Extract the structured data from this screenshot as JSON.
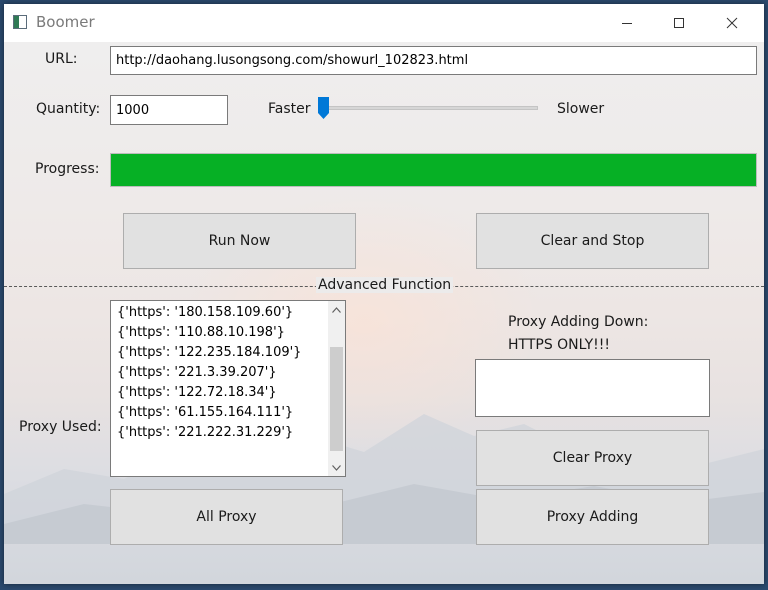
{
  "window": {
    "title": "Boomer"
  },
  "url": {
    "label": "URL:",
    "value": "http://daohang.lusongsong.com/showurl_102823.html"
  },
  "quantity": {
    "label": "Quantity:",
    "value": "1000"
  },
  "speed": {
    "faster_label": "Faster",
    "slower_label": "Slower",
    "level_fraction": 0.0
  },
  "progress": {
    "label": "Progress:",
    "fraction": 1.0,
    "color": "#06b025"
  },
  "buttons": {
    "run_now": "Run Now",
    "clear_and_stop": "Clear and Stop",
    "all_proxy": "All Proxy",
    "clear_proxy": "Clear Proxy",
    "proxy_adding": "Proxy Adding"
  },
  "advanced": {
    "label": "Advanced Function"
  },
  "proxy_used": {
    "label": "Proxy Used:",
    "items": [
      "{'https': '180.158.109.60'}",
      "{'https': '110.88.10.198'}",
      "{'https': '122.235.184.109'}",
      "{'https': '221.3.39.207'}",
      "{'https': '122.72.18.34'}",
      "{'https': '61.155.164.111'}",
      "{'https': '221.222.31.229'}"
    ]
  },
  "proxy_adding": {
    "label_line1": "Proxy Adding Down:",
    "label_line2": "HTTPS ONLY!!!",
    "value": ""
  },
  "icons": {
    "app": "app-window-icon",
    "minimize": "minimize-icon",
    "maximize": "maximize-icon",
    "close": "close-icon",
    "slider_thumb": "slider-thumb",
    "scroll_up": "chevron-up-icon",
    "scroll_down": "chevron-down-icon"
  },
  "colors": {
    "slider_accent": "#0078d7",
    "progress_fill": "#06b025"
  }
}
